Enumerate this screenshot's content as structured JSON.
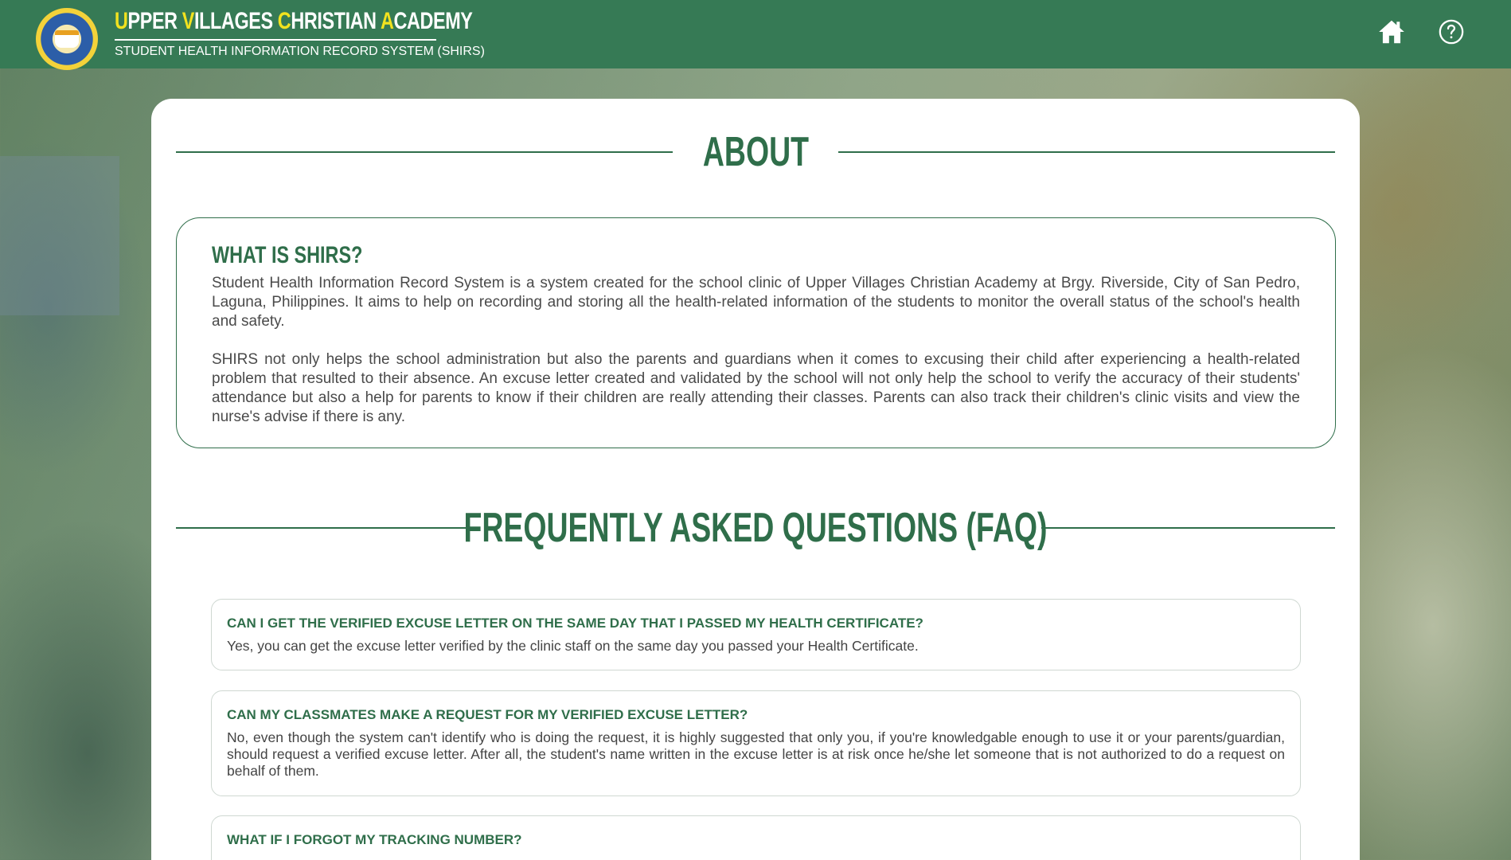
{
  "header": {
    "title_parts": [
      {
        "cap": "U",
        "rest": "PPER "
      },
      {
        "cap": "V",
        "rest": "ILLAGES "
      },
      {
        "cap": "C",
        "rest": "HRISTIAN "
      },
      {
        "cap": "A",
        "rest": "CADEMY"
      }
    ],
    "subtitle": "STUDENT HEALTH INFORMATION RECORD SYSTEM (SHIRS)",
    "nav": {
      "home_icon": "home-icon",
      "help_icon": "help-circle-icon"
    }
  },
  "about": {
    "heading": "ABOUT",
    "box_title": "WHAT IS SHIRS?",
    "paragraphs": [
      "Student Health Information Record System is a system created for the school clinic of Upper Villages Christian Academy at Brgy. Riverside, City of San Pedro, Laguna, Philippines. It aims to help on recording and storing all the health-related information of the students to monitor the overall status of the school's health and safety.",
      "SHIRS not only helps the school administration but also the parents and guardians when it comes to excusing their child after experiencing a health-related problem that resulted to their absence. An excuse letter created and validated by the school will not only help the school to verify the accuracy of their students' attendance but also a help for parents to know if their children are really attending their classes. Parents can also track their children's clinic visits and view the nurse's advise if there is any."
    ]
  },
  "faq": {
    "heading": "FREQUENTLY ASKED QUESTIONS (FAQ)",
    "items": [
      {
        "question": "CAN I GET THE VERIFIED EXCUSE LETTER ON THE SAME DAY THAT I PASSED MY HEALTH CERTIFICATE?",
        "answer": "Yes, you can get the excuse letter verified by the clinic staff on the same day you passed your Health Certificate."
      },
      {
        "question": "CAN MY CLASSMATES MAKE A REQUEST FOR MY VERIFIED EXCUSE LETTER?",
        "answer": "No, even though the system can't identify who is doing the request, it is highly suggested that only you, if you're knowledgable enough to use it or your parents/guardian, should request a verified excuse letter. After all, the student's name written in the excuse letter is at risk once he/she let someone that is not authorized to do a request on behalf of them."
      },
      {
        "question": "WHAT IF I FORGOT MY TRACKING NUMBER?",
        "answer": ""
      }
    ]
  },
  "colors": {
    "header_bg": "#367a55",
    "accent_green": "#2f6e4a",
    "title_caps_yellow": "#f2e21f"
  }
}
